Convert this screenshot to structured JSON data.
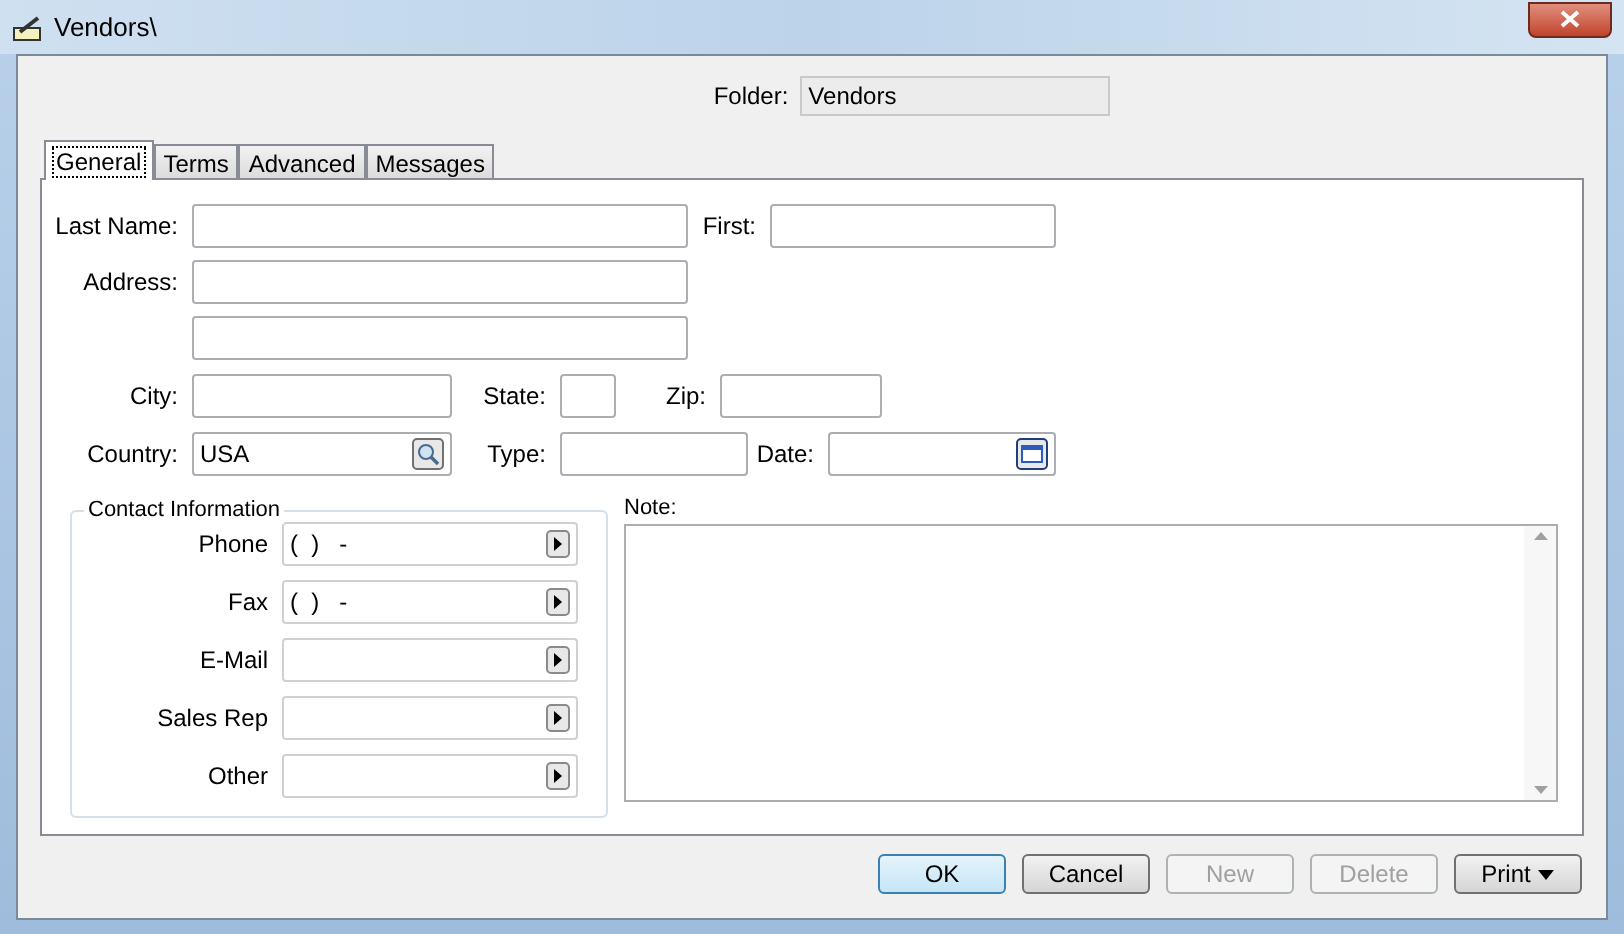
{
  "window": {
    "title": "Vendors\\"
  },
  "folder": {
    "label": "Folder:",
    "value": "Vendors"
  },
  "tabs": [
    {
      "label": "General",
      "selected": true
    },
    {
      "label": "Terms",
      "selected": false
    },
    {
      "label": "Advanced",
      "selected": false
    },
    {
      "label": "Messages",
      "selected": false
    }
  ],
  "last_name": {
    "label": "Last Name:"
  },
  "first": {
    "label": "First:"
  },
  "address": {
    "label": "Address:"
  },
  "city": {
    "label": "City:"
  },
  "state": {
    "label": "State:"
  },
  "zip": {
    "label": "Zip:"
  },
  "country": {
    "label": "Country:",
    "value": "USA"
  },
  "type": {
    "label": "Type:"
  },
  "date": {
    "label": "Date:"
  },
  "contact": {
    "title": "Contact Information",
    "rows": [
      {
        "label": "Phone",
        "value": "(  )   -"
      },
      {
        "label": "Fax",
        "value": "(  )   -"
      },
      {
        "label": "E-Mail"
      },
      {
        "label": "Sales Rep"
      },
      {
        "label": "Other"
      }
    ]
  },
  "note": {
    "label": "Note:"
  },
  "buttons": [
    {
      "label": "OK",
      "kind": "default",
      "disabled": false
    },
    {
      "label": "Cancel",
      "kind": "plain",
      "disabled": false
    },
    {
      "label": "New",
      "kind": "plain",
      "disabled": true
    },
    {
      "label": "Delete",
      "kind": "plain",
      "disabled": true
    },
    {
      "label": "Print",
      "kind": "menu",
      "disabled": false
    }
  ]
}
